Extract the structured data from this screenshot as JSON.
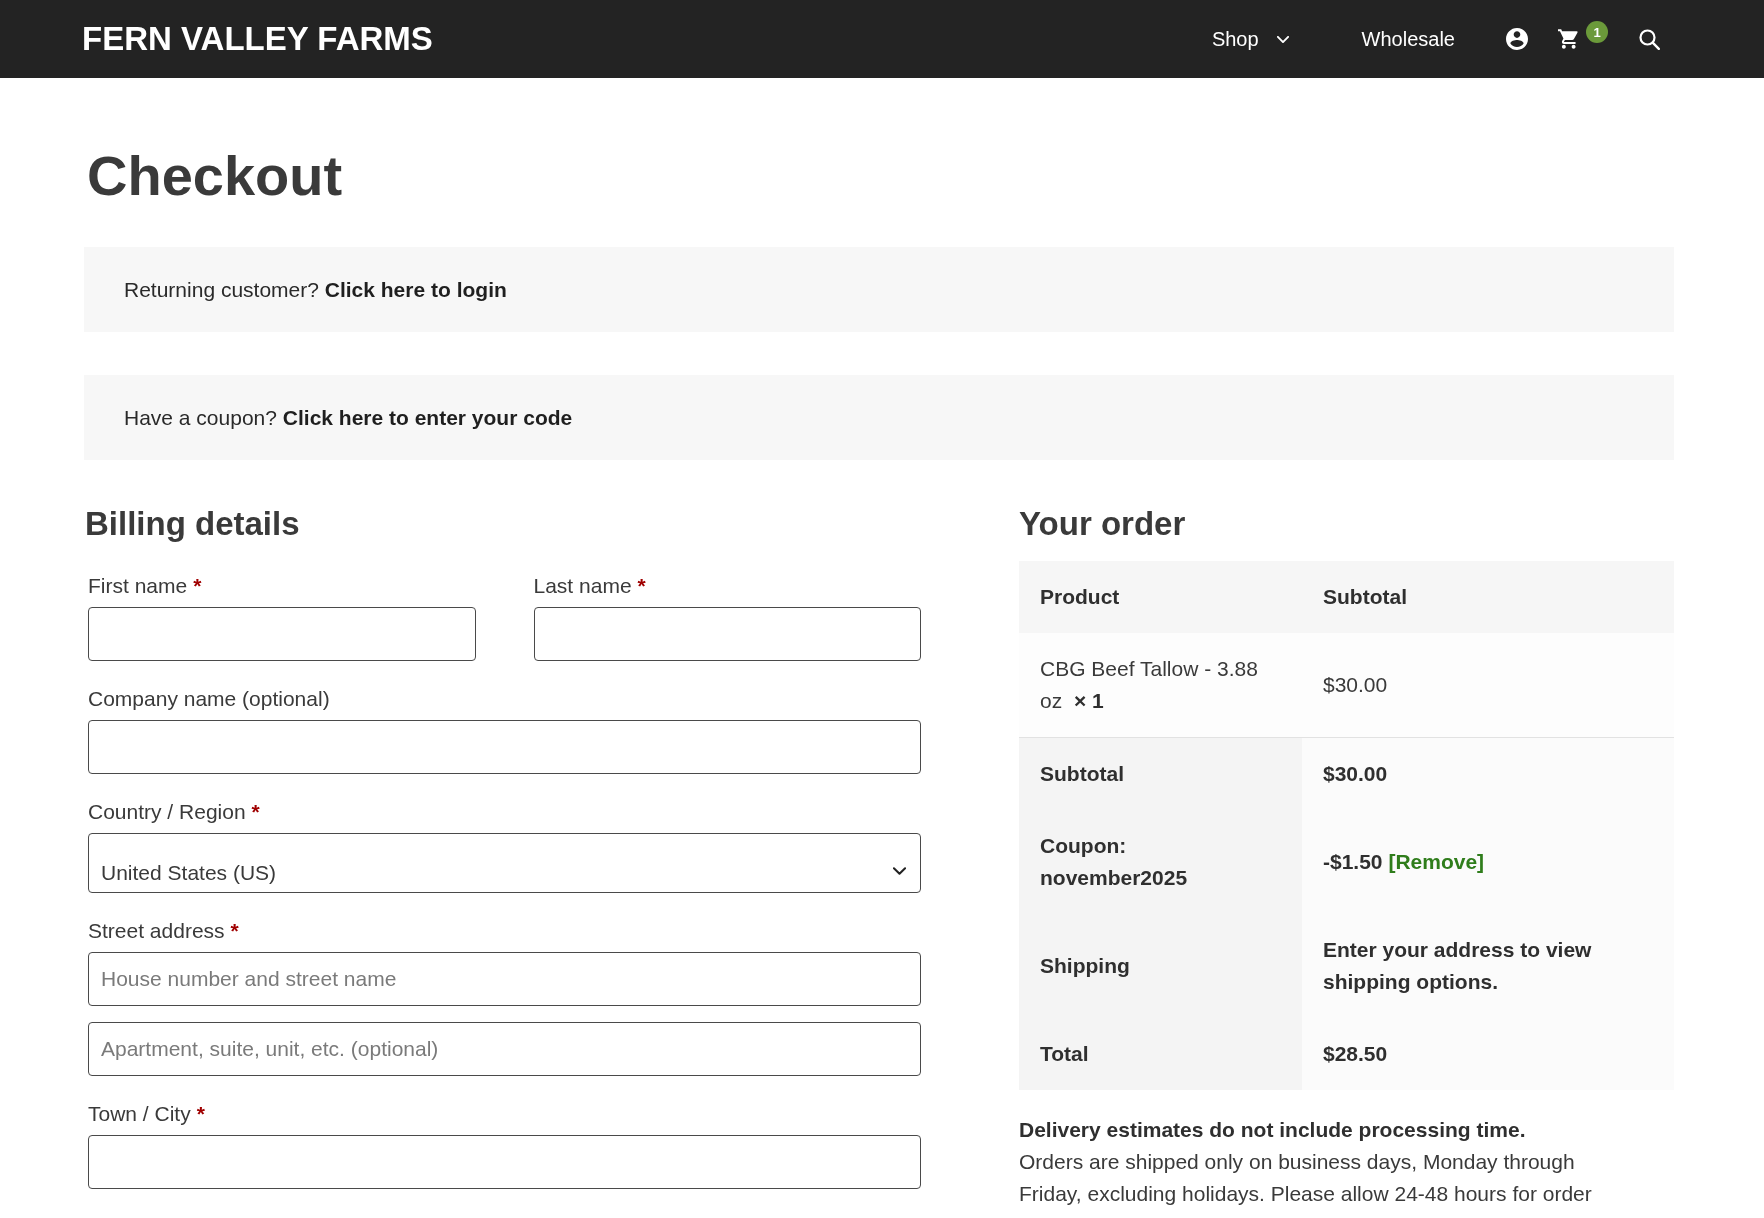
{
  "header": {
    "logo": "FERN VALLEY FARMS",
    "nav": [
      {
        "label": "Shop",
        "kind": "menu"
      },
      {
        "label": "Wholesale",
        "kind": "link"
      }
    ],
    "cart_count": "1"
  },
  "page_title": "Checkout",
  "notices": [
    {
      "text": "Returning customer?",
      "link": "Click here to login"
    },
    {
      "text": "Have a coupon?",
      "link": "Click here to enter your code"
    }
  ],
  "billing": {
    "title": "Billing details",
    "rows": [
      [
        {
          "label": "First name",
          "required_mark": "*",
          "kind": "text"
        },
        {
          "label": "Last name",
          "required_mark": "*",
          "kind": "text"
        }
      ],
      [
        {
          "label": "Company name (optional)",
          "kind": "text"
        }
      ],
      [
        {
          "label": "Country / Region",
          "required_mark": "*",
          "kind": "select",
          "value": "United States (US)"
        }
      ],
      [
        {
          "label": "Street address",
          "required_mark": "*",
          "kind": "text",
          "placeholder": "House number and street name"
        }
      ],
      [
        {
          "kind": "text",
          "placeholder": "Apartment, suite, unit, etc. (optional)"
        }
      ],
      [
        {
          "label": "Town / City",
          "required_mark": "*",
          "kind": "text"
        }
      ]
    ]
  },
  "order": {
    "title": "Your order",
    "columns": [
      "Product",
      "Subtotal"
    ],
    "items": [
      {
        "name": "CBG Beef Tallow - 3.88 oz",
        "quantity": "× 1",
        "subtotal": "$30.00"
      }
    ],
    "totals": [
      {
        "label": "Subtotal",
        "value": "$30.00"
      },
      {
        "label": "Coupon: november2025",
        "value": "-$1.50",
        "link": "[Remove]"
      },
      {
        "label": "Shipping",
        "value": "Enter your address to view shipping options."
      },
      {
        "label": "Total",
        "value": "$28.50"
      }
    ]
  },
  "delivery_note": {
    "title": "Delivery estimates do not include processing time.",
    "text": "Orders are shipped only on business days, Monday through Friday, excluding holidays. Please allow 24-48 hours for order"
  }
}
